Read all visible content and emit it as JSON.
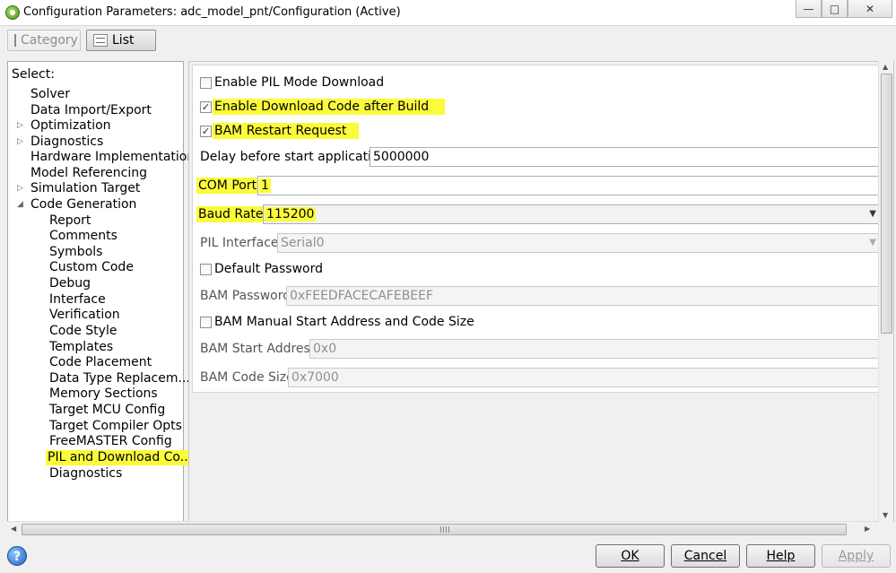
{
  "window": {
    "title": "Configuration Parameters: adc_model_pnt/Configuration (Active)",
    "minimize_glyph": "—",
    "maximize_glyph": "□",
    "close_glyph": "✕"
  },
  "toolbar": {
    "category_label": "Category",
    "list_label": "List"
  },
  "tree": {
    "header": "Select:",
    "items": [
      {
        "label": "Solver"
      },
      {
        "label": "Data Import/Export"
      },
      {
        "label": "Optimization"
      },
      {
        "label": "Diagnostics"
      },
      {
        "label": "Hardware Implementation"
      },
      {
        "label": "Model Referencing"
      },
      {
        "label": "Simulation Target"
      },
      {
        "label": "Code Generation"
      },
      {
        "label": "Report"
      },
      {
        "label": "Comments"
      },
      {
        "label": "Symbols"
      },
      {
        "label": "Custom Code"
      },
      {
        "label": "Debug"
      },
      {
        "label": "Interface"
      },
      {
        "label": "Verification"
      },
      {
        "label": "Code Style"
      },
      {
        "label": "Templates"
      },
      {
        "label": "Code Placement"
      },
      {
        "label": "Data Type Replacem..."
      },
      {
        "label": "Memory Sections"
      },
      {
        "label": "Target MCU Config"
      },
      {
        "label": "Target Compiler Opts"
      },
      {
        "label": "FreeMASTER Config"
      },
      {
        "label": "PIL and Download Co..."
      },
      {
        "label": "Diagnostics"
      }
    ],
    "collapsed_arrow": "▷",
    "expanded_arrow": "◢"
  },
  "form": {
    "enable_pil_mode_download": {
      "label": "Enable PIL Mode Download",
      "checked": false
    },
    "enable_download_code": {
      "label": "Enable Download Code after Build",
      "checked": true
    },
    "bam_restart_request": {
      "label": "BAM Restart Request",
      "checked": true
    },
    "delay_before_start": {
      "label": "Delay before start application",
      "value": "5000000"
    },
    "com_port": {
      "label": "COM Port",
      "value": "1"
    },
    "baud_rate": {
      "label": "Baud Rate",
      "value": "115200"
    },
    "pil_interface": {
      "label": "PIL Interface",
      "value": "Serial0"
    },
    "default_password": {
      "label": "Default Password",
      "checked": false
    },
    "bam_password": {
      "label": "BAM Password",
      "value": "0xFEEDFACECAFEBEEF"
    },
    "bam_manual_start": {
      "label": "BAM Manual Start Address and Code Size",
      "checked": false
    },
    "bam_start_address": {
      "label": "BAM Start Address",
      "value": "0x0"
    },
    "bam_code_size": {
      "label": "BAM Code Size",
      "value": "0x7000"
    },
    "check_glyph": "✓",
    "dropdown_glyph": "▼"
  },
  "buttons": {
    "help_glyph": "?",
    "ok": "OK",
    "cancel": "Cancel",
    "help": "Help",
    "apply": "Apply"
  },
  "colors": {
    "highlight": "#fbfb3c"
  }
}
